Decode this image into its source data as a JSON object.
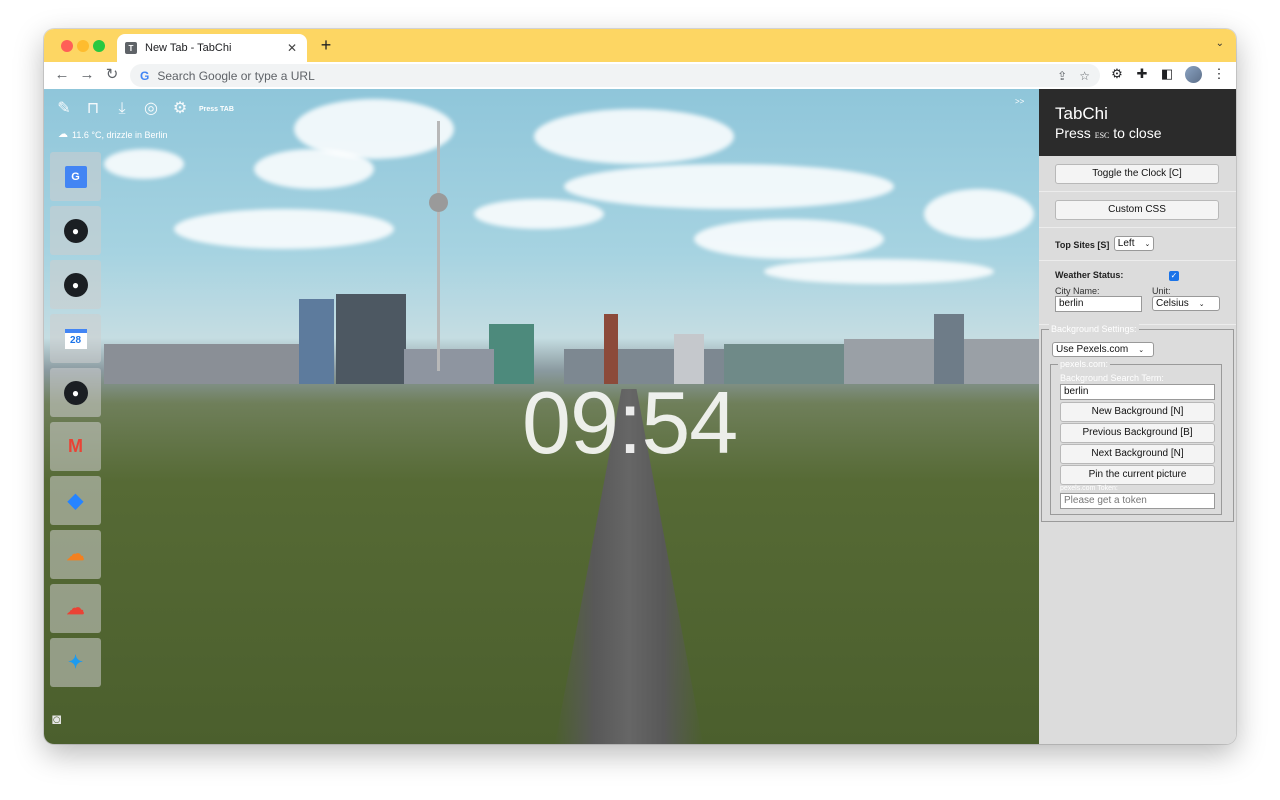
{
  "browser": {
    "tab_title": "New Tab - TabChi",
    "tab_favicon": "T",
    "omnibox_placeholder": "Search Google or type a URL"
  },
  "overlay": {
    "press_tab": "Press TAB",
    "weather_text": "11.6 °C, drizzle in Berlin",
    "expand_label": ">>",
    "clock": "09:54"
  },
  "top_sites": [
    {
      "name": "google-translate"
    },
    {
      "name": "github"
    },
    {
      "name": "github"
    },
    {
      "name": "google-calendar",
      "label": "28"
    },
    {
      "name": "github"
    },
    {
      "name": "gmail"
    },
    {
      "name": "jira"
    },
    {
      "name": "cloudflare"
    },
    {
      "name": "google-cloud"
    },
    {
      "name": "twitter"
    }
  ],
  "panel": {
    "title": "TabChi",
    "subtitle_pre": "Press ",
    "subtitle_key": "esc",
    "subtitle_post": " to close",
    "toggle_clock": "Toggle the Clock [C]",
    "custom_css": "Custom CSS",
    "top_sites_label": "Top Sites [S]",
    "top_sites_value": "Left",
    "weather_label": "Weather Status:",
    "city_label": "City Name:",
    "city_value": "berlin",
    "unit_label": "Unit:",
    "unit_value": "Celsius",
    "bg_settings_legend": "Background Settings:",
    "bg_source": "Use Pexels.com",
    "pexels_legend": "pexels.com:",
    "search_term_label": "Background Search Term:",
    "search_term_value": "berlin",
    "new_bg": "New Background [N]",
    "prev_bg": "Previous Background [B]",
    "next_bg": "Next Background [N]",
    "pin_bg": "Pin the current picture",
    "token_label": "pexels.com Token:",
    "token_placeholder": "Please get a token"
  },
  "colors": {
    "tabbar": "#fdd663",
    "panel_header": "#2b2b2b",
    "panel_bg": "#dcdcdc",
    "checkbox": "#1a73e8"
  }
}
